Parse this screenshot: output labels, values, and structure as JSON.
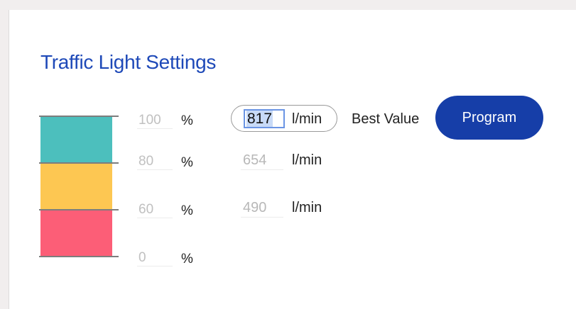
{
  "panel": {
    "title": "Traffic Light Settings"
  },
  "traffic_light": {
    "segments": [
      {
        "name": "green",
        "color": "#4cbfbd"
      },
      {
        "name": "yellow",
        "color": "#fdc752"
      },
      {
        "name": "red",
        "color": "#fc5e77"
      }
    ]
  },
  "thresholds": {
    "percent_unit": "%",
    "percent_values": [
      "100",
      "80",
      "60",
      "0"
    ],
    "flow_unit": "l/min",
    "flow_values": [
      "817",
      "654",
      "490"
    ]
  },
  "best_value": {
    "label": "Best Value"
  },
  "program_button": {
    "label": "Program",
    "color": "#163ea8"
  }
}
